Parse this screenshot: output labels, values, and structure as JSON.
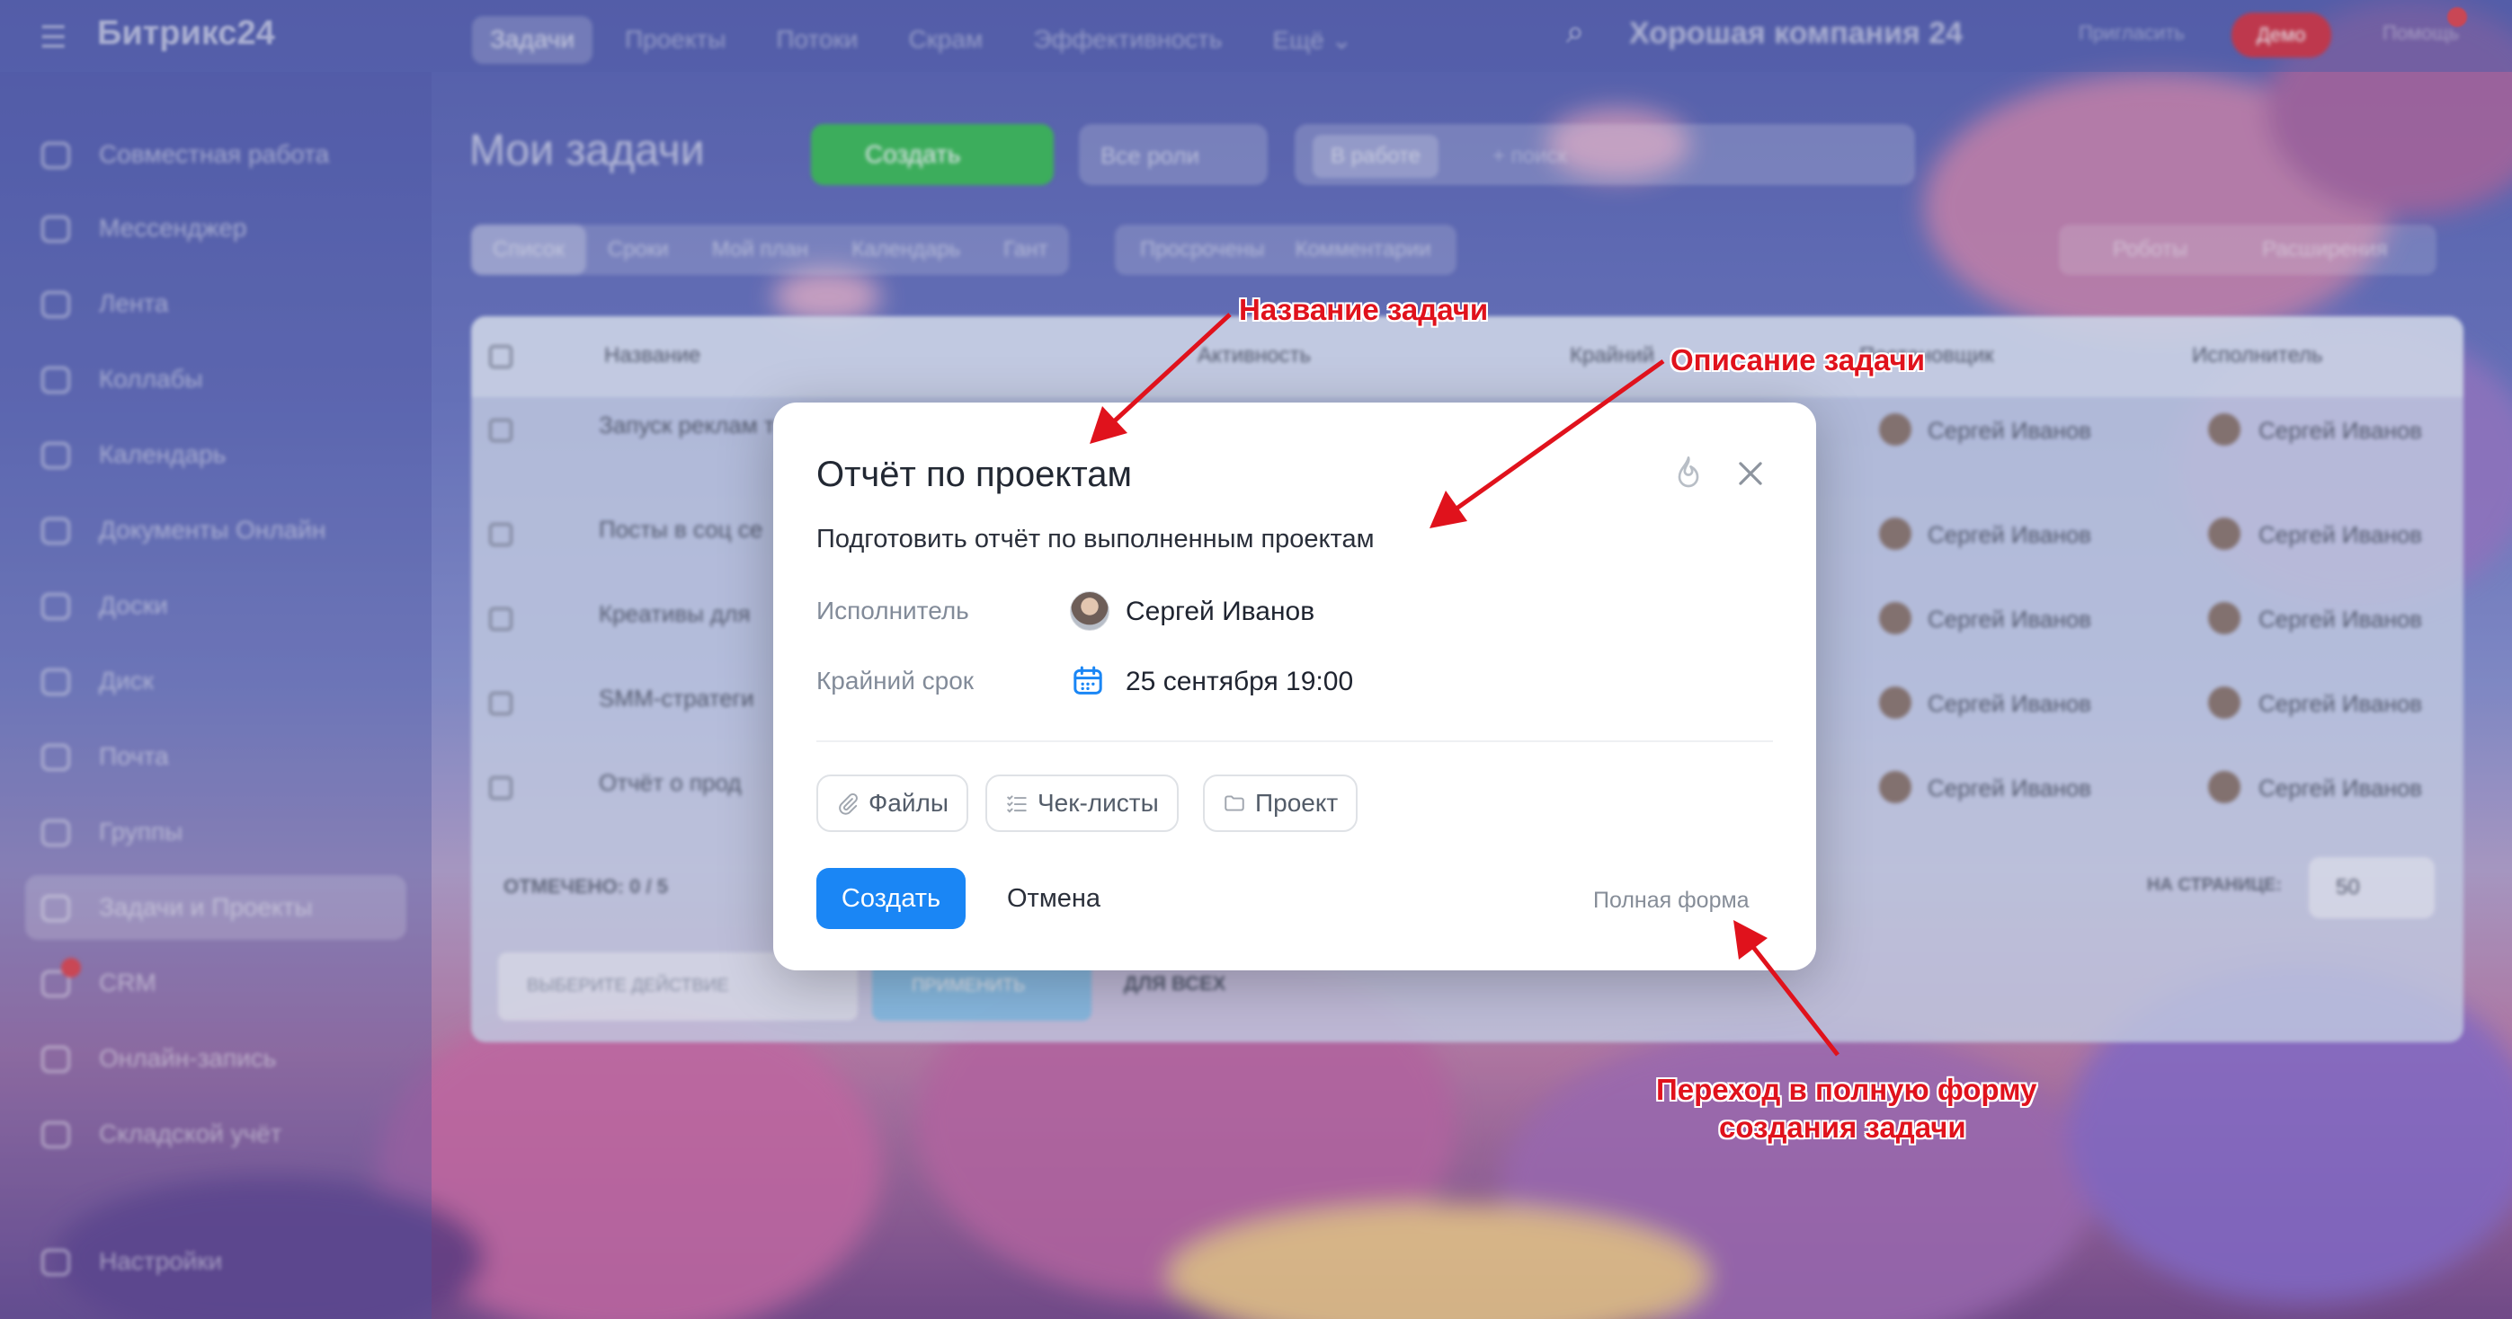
{
  "app": {
    "logo": "Битрикс24",
    "company": "Хорошая компания 24",
    "invite": "Пригласить",
    "demo": "Демо",
    "help": "Помощь"
  },
  "topnav": [
    "Задачи",
    "Проекты",
    "Потоки",
    "Скрам",
    "Эффективность",
    "Ещё ⌄"
  ],
  "sidebar": [
    {
      "label": "Совместная работа"
    },
    {
      "label": "Мессенджер"
    },
    {
      "label": "Лента"
    },
    {
      "label": "Коллабы"
    },
    {
      "label": "Календарь"
    },
    {
      "label": "Документы Онлайн"
    },
    {
      "label": "Доски"
    },
    {
      "label": "Диск"
    },
    {
      "label": "Почта"
    },
    {
      "label": "Группы"
    },
    {
      "label": "Задачи и Проекты"
    },
    {
      "label": "CRM"
    },
    {
      "label": "Онлайн-запись"
    },
    {
      "label": "Складской учёт"
    },
    {
      "label": "Настройки"
    }
  ],
  "page": {
    "title": "Мои задачи",
    "create_label": "Создать",
    "roles_label": "Все роли",
    "filter_chip": "В работе",
    "search_placeholder": "+ поиск",
    "view_tabs": [
      "Список",
      "Сроки",
      "Мой план",
      "Календарь",
      "Гант"
    ],
    "counters": [
      "Просрочены",
      "Комментарии"
    ],
    "right_controls": [
      "Роботы",
      "Расширения"
    ]
  },
  "grid": {
    "headers": {
      "name": "Название",
      "activity": "Активность",
      "deadline": "Крайний",
      "creator": "Постановщик",
      "assignee": "Исполнитель"
    },
    "rows": [
      {
        "title": "Запуск реклам тестирование",
        "creator": "Сергей Иванов",
        "assignee": "Сергей Иванов"
      },
      {
        "title": "Посты в соц се",
        "creator": "Сергей Иванов",
        "assignee": "Сергей Иванов"
      },
      {
        "title": "Креативы для",
        "creator": "Сергей Иванов",
        "assignee": "Сергей Иванов"
      },
      {
        "title": "SMM-стратеги",
        "creator": "Сергей Иванов",
        "assignee": "Сергей Иванов"
      },
      {
        "title": "Отчёт о прод",
        "creator": "Сергей Иванов",
        "assignee": "Сергей Иванов"
      }
    ],
    "marked": "ОТМЕЧЕНО: 0 / 5",
    "per_page_label": "НА СТРАНИЦЕ:",
    "per_page": "50",
    "action_placeholder": "ВЫБЕРИТЕ ДЕЙСТВИЕ",
    "apply": "ПРИМЕНИТЬ",
    "for_all": "ДЛЯ ВСЕХ"
  },
  "modal": {
    "title": "Отчёт по проектам",
    "description": "Подготовить отчёт по выполненным проектам",
    "assignee_label": "Исполнитель",
    "assignee": "Сергей Иванов",
    "deadline_label": "Крайний срок",
    "deadline": "25 сентября 19:00",
    "chips": [
      "Файлы",
      "Чек-листы",
      "Проект"
    ],
    "create": "Создать",
    "cancel": "Отмена",
    "full_form": "Полная форма"
  },
  "callouts": {
    "task_name": "Название задачи",
    "task_description": "Описание задачи",
    "full_form_1": "Переход в полную форму",
    "full_form_2": "создания задачи"
  },
  "colors": {
    "accent": "#1a86f5",
    "callout": "#e0121c",
    "create_green": "#3fbf5a",
    "demo_red": "#d33a49"
  }
}
